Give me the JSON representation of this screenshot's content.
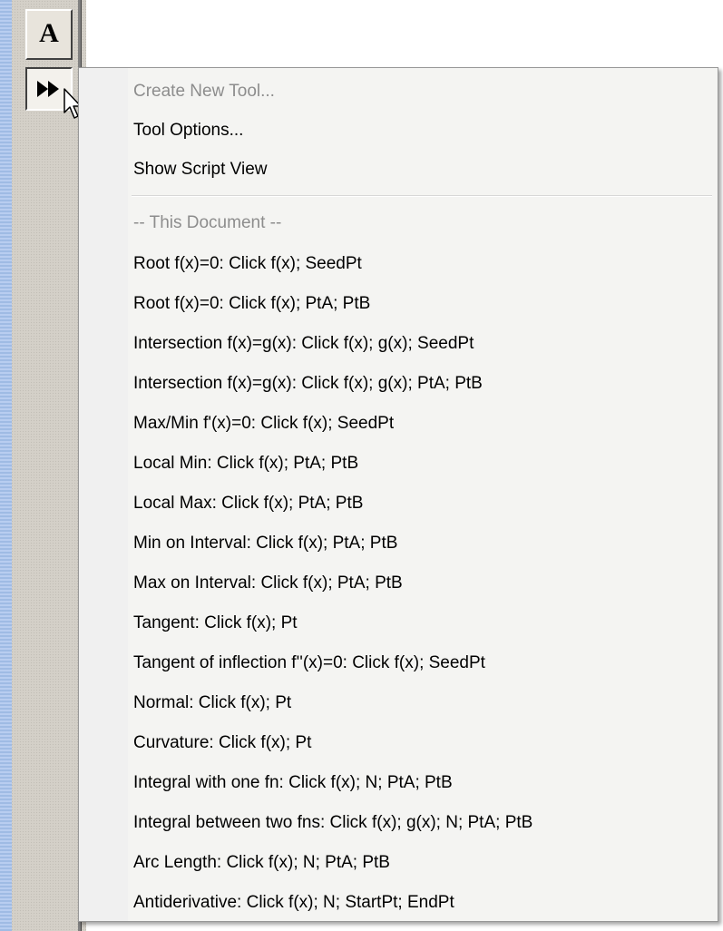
{
  "toolbar": {
    "text_tool_label": "A",
    "more_tools_icon": "fast-forward-icon",
    "cursor_icon": "mouse-pointer-icon"
  },
  "menu": {
    "top_items": [
      {
        "label": "Create New Tool...",
        "enabled": false
      },
      {
        "label": "Tool Options...",
        "enabled": true
      },
      {
        "label": "Show Script View",
        "enabled": true
      }
    ],
    "section_header": "-- This Document --",
    "tools": [
      "Root f(x)=0: Click f(x); SeedPt",
      "Root f(x)=0: Click f(x); PtA; PtB",
      "Intersection f(x)=g(x): Click f(x); g(x); SeedPt",
      "Intersection f(x)=g(x): Click f(x); g(x); PtA; PtB",
      "Max/Min f'(x)=0: Click f(x); SeedPt",
      "Local Min: Click f(x); PtA; PtB",
      "Local Max: Click f(x); PtA; PtB",
      "Min on Interval: Click f(x); PtA; PtB",
      "Max on Interval: Click f(x); PtA; PtB",
      "Tangent: Click f(x); Pt",
      "Tangent of inflection f''(x)=0: Click f(x); SeedPt",
      "Normal: Click f(x); Pt",
      "Curvature: Click f(x); Pt",
      "Integral with one fn: Click f(x); N; PtA; PtB",
      "Integral between two fns: Click f(x); g(x); N; PtA; PtB",
      "Arc Length: Click f(x); N; PtA; PtB",
      "Antiderivative: Click f(x); N; StartPt; EndPt"
    ]
  },
  "colors": {
    "toolbar_bg": "#d4d0c8",
    "menu_bg": "#f4f4f2",
    "disabled_text": "#8d8d8d"
  }
}
